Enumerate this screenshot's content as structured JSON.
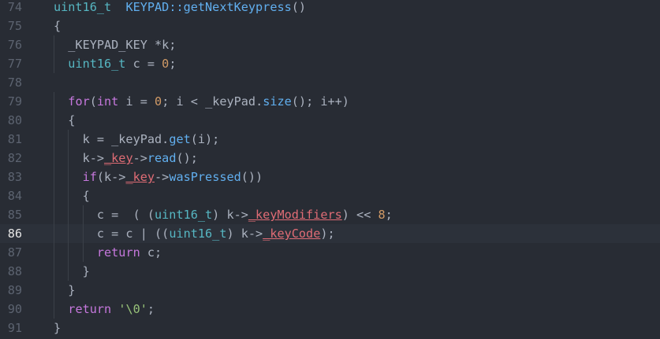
{
  "editor": {
    "current_line": 86,
    "colors": {
      "background": "#282c34",
      "current_line_bg": "#2c313a",
      "gutter": "#5c6370",
      "keyword": "#c678dd",
      "type": "#56b6c2",
      "function": "#61afef",
      "number": "#d19a66",
      "member": "#e06c75",
      "string": "#98c379",
      "text": "#abb2bf"
    },
    "lines": [
      {
        "num": "74",
        "tokens": [
          {
            "t": "uint16_t",
            "c": "type"
          },
          {
            "t": "  ",
            "c": "txt"
          },
          {
            "t": "KEYPAD::getNextKeypress",
            "c": "fn"
          },
          {
            "t": "()",
            "c": "txt"
          }
        ]
      },
      {
        "num": "75",
        "tokens": [
          {
            "t": "{",
            "c": "txt"
          }
        ]
      },
      {
        "num": "76",
        "tokens": [
          {
            "t": "  _KEYPAD_KEY *k;",
            "c": "txt"
          }
        ]
      },
      {
        "num": "77",
        "tokens": [
          {
            "t": "  ",
            "c": "txt"
          },
          {
            "t": "uint16_t",
            "c": "type"
          },
          {
            "t": " c = ",
            "c": "txt"
          },
          {
            "t": "0",
            "c": "num"
          },
          {
            "t": ";",
            "c": "txt"
          }
        ]
      },
      {
        "num": "78",
        "tokens": []
      },
      {
        "num": "79",
        "tokens": [
          {
            "t": "  ",
            "c": "txt"
          },
          {
            "t": "for",
            "c": "kw"
          },
          {
            "t": "(",
            "c": "txt"
          },
          {
            "t": "int",
            "c": "kw"
          },
          {
            "t": " i = ",
            "c": "txt"
          },
          {
            "t": "0",
            "c": "num"
          },
          {
            "t": "; i < _keyPad.",
            "c": "txt"
          },
          {
            "t": "size",
            "c": "fn"
          },
          {
            "t": "(); i++)",
            "c": "txt"
          }
        ]
      },
      {
        "num": "80",
        "tokens": [
          {
            "t": "  {",
            "c": "txt"
          }
        ]
      },
      {
        "num": "81",
        "tokens": [
          {
            "t": "    k = _keyPad.",
            "c": "txt"
          },
          {
            "t": "get",
            "c": "fn"
          },
          {
            "t": "(i);",
            "c": "txt"
          }
        ]
      },
      {
        "num": "82",
        "tokens": [
          {
            "t": "    k->",
            "c": "txt"
          },
          {
            "t": "_key",
            "c": "mem"
          },
          {
            "t": "->",
            "c": "txt"
          },
          {
            "t": "read",
            "c": "fn"
          },
          {
            "t": "();",
            "c": "txt"
          }
        ]
      },
      {
        "num": "83",
        "tokens": [
          {
            "t": "    ",
            "c": "txt"
          },
          {
            "t": "if",
            "c": "kw"
          },
          {
            "t": "(k->",
            "c": "txt"
          },
          {
            "t": "_key",
            "c": "mem"
          },
          {
            "t": "->",
            "c": "txt"
          },
          {
            "t": "wasPressed",
            "c": "fn"
          },
          {
            "t": "())",
            "c": "txt"
          }
        ]
      },
      {
        "num": "84",
        "tokens": [
          {
            "t": "    {",
            "c": "txt"
          }
        ]
      },
      {
        "num": "85",
        "tokens": [
          {
            "t": "      c =  ( (",
            "c": "txt"
          },
          {
            "t": "uint16_t",
            "c": "type"
          },
          {
            "t": ") k->",
            "c": "txt"
          },
          {
            "t": "_keyModifiers",
            "c": "mem"
          },
          {
            "t": ") << ",
            "c": "txt"
          },
          {
            "t": "8",
            "c": "num"
          },
          {
            "t": ";",
            "c": "txt"
          }
        ]
      },
      {
        "num": "86",
        "tokens": [
          {
            "t": "      c = c | ((",
            "c": "txt"
          },
          {
            "t": "uint16_t",
            "c": "type"
          },
          {
            "t": ") k->",
            "c": "txt"
          },
          {
            "t": "_keyCode",
            "c": "mem"
          },
          {
            "t": ");",
            "c": "txt"
          }
        ]
      },
      {
        "num": "87",
        "tokens": [
          {
            "t": "      ",
            "c": "txt"
          },
          {
            "t": "return",
            "c": "kw"
          },
          {
            "t": " c;",
            "c": "txt"
          }
        ]
      },
      {
        "num": "88",
        "tokens": [
          {
            "t": "    }",
            "c": "txt"
          }
        ]
      },
      {
        "num": "89",
        "tokens": [
          {
            "t": "  }",
            "c": "txt"
          }
        ]
      },
      {
        "num": "90",
        "tokens": [
          {
            "t": "  ",
            "c": "txt"
          },
          {
            "t": "return",
            "c": "kw"
          },
          {
            "t": " ",
            "c": "txt"
          },
          {
            "t": "'\\0'",
            "c": "str"
          },
          {
            "t": ";",
            "c": "txt"
          }
        ]
      },
      {
        "num": "91",
        "tokens": [
          {
            "t": "}",
            "c": "txt"
          }
        ]
      }
    ]
  }
}
